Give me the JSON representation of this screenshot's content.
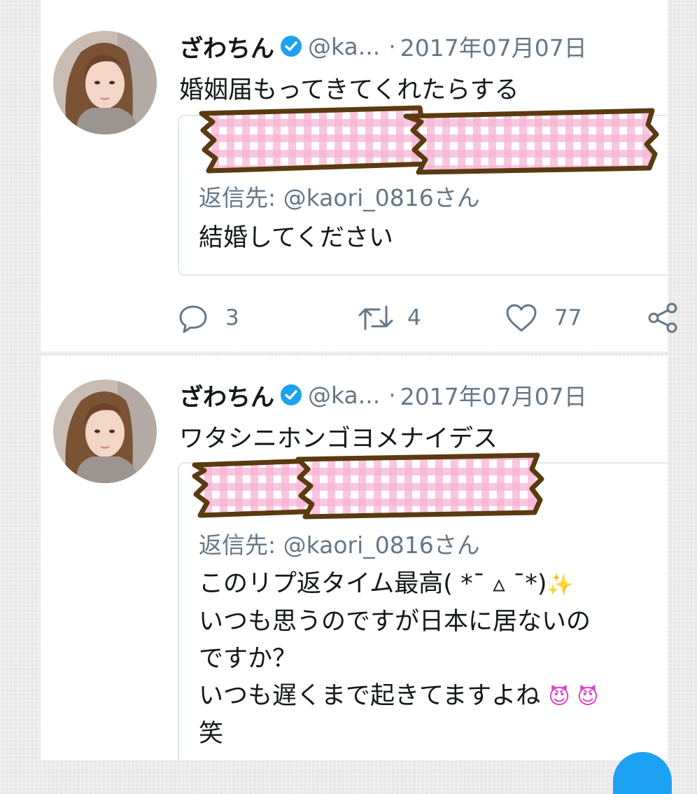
{
  "tweets": [
    {
      "name": "ざわちん",
      "handle": "@ka...",
      "dot": "·",
      "date": "2017年07月07日",
      "text": "婚姻届もってきてくれたらする",
      "quote": {
        "reply_to": "返信先: @kaori_0816さん",
        "lines": [
          "結婚してください"
        ]
      },
      "actions": {
        "reply_count": "3",
        "retweet_count": "4",
        "like_count": "77"
      }
    },
    {
      "name": "ざわちん",
      "handle": "@ka...",
      "dot": "·",
      "date": "2017年07月07日",
      "text": "ワタシニホンゴヨメナイデス",
      "quote": {
        "reply_to": "返信先: @kaori_0816さん",
        "lines": [
          "このリプ返タイム最高( *¯ ▵ ¯*)",
          "いつも思うのですが日本に居ないの",
          "ですか？",
          "いつも遅くまで起きてますよね",
          "笑"
        ],
        "emoji": {
          "sparkle": "✨",
          "faces": "😈 😈"
        }
      }
    }
  ],
  "colors": {
    "verified": "#1da1f2",
    "secondary_text": "#657786",
    "primary_text": "#14171a",
    "tape_pink": "#f7b4d4",
    "tape_brown": "#5a3a10"
  },
  "icons": [
    "verified-badge-icon",
    "reply-icon",
    "retweet-icon",
    "like-icon",
    "share-icon"
  ]
}
